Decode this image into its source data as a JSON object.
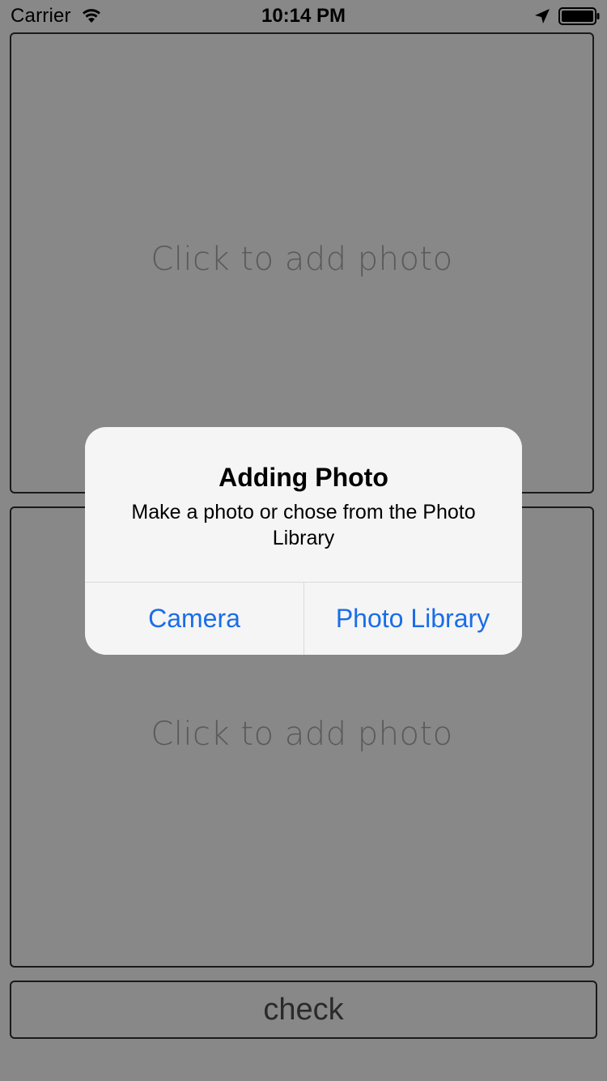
{
  "status_bar": {
    "carrier": "Carrier",
    "time": "10:14 PM"
  },
  "photo_slots": [
    {
      "placeholder": "Click to add photo"
    },
    {
      "placeholder": "Click to add photo"
    }
  ],
  "check_button": {
    "label": "check"
  },
  "alert": {
    "title": "Adding Photo",
    "message": "Make a photo or chose from the Photo Library",
    "buttons": [
      {
        "label": "Camera"
      },
      {
        "label": "Photo Library"
      }
    ]
  },
  "colors": {
    "background": "#888888",
    "alert_background": "#f5f5f5",
    "action_blue": "#1a6de8",
    "placeholder_text": "#5a5a5a"
  }
}
